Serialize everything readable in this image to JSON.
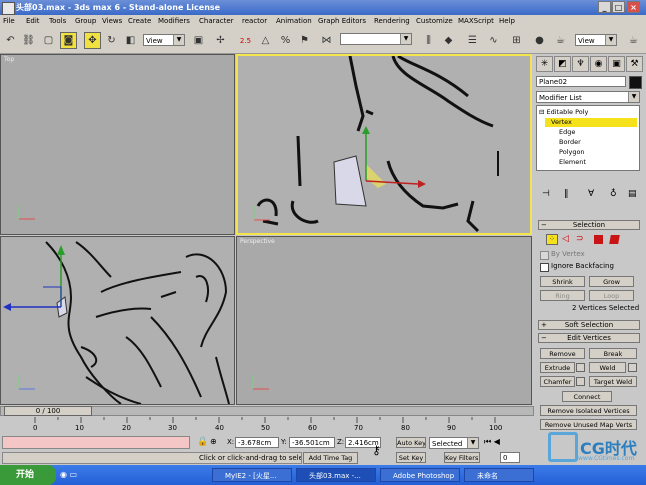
{
  "window": {
    "title": "头部03.max - 3ds max 6 - Stand-alone License",
    "min": "_",
    "max": "□",
    "close": "×"
  },
  "menu": [
    "File",
    "Edit",
    "Tools",
    "Group",
    "Views",
    "Create",
    "Modifiers",
    "Character",
    "reactor",
    "Animation",
    "Graph Editors",
    "Rendering",
    "Customize",
    "MAXScript",
    "Help"
  ],
  "toolbar": {
    "ref_coord": "View",
    "angle_snap": "2.5",
    "named_sel": "",
    "render_view": "View"
  },
  "viewports": {
    "top": "Top",
    "front": "",
    "left": "",
    "perspective": "Perspective"
  },
  "command_panel": {
    "object_name": "Plane02",
    "modifier_list": "Modifier List",
    "stack": [
      "Editable Poly",
      "Vertex",
      "Edge",
      "Border",
      "Polygon",
      "Element"
    ],
    "selection": {
      "title": "Selection",
      "by_vertex": "By Vertex",
      "ignore_backfacing": "Ignore Backfacing",
      "shrink": "Shrink",
      "grow": "Grow",
      "ring": "Ring",
      "loop": "Loop",
      "status": "2 Vertices Selected"
    },
    "soft_selection": "Soft Selection",
    "edit_vertices": {
      "title": "Edit Vertices",
      "remove": "Remove",
      "break": "Break",
      "extrude": "Extrude",
      "weld": "Weld",
      "chamfer": "Chamfer",
      "target_weld": "Target Weld",
      "connect": "Connect",
      "remove_isolated": "Remove Isolated Vertices",
      "remove_unused": "Remove Unused Map Verts"
    }
  },
  "timeline": {
    "frame": "0 / 100",
    "ticks": [
      "0",
      "10",
      "20",
      "30",
      "40",
      "50",
      "60",
      "70",
      "80",
      "90",
      "100"
    ]
  },
  "status": {
    "prompt": "Click or click-and-drag to select ob",
    "x_label": "X:",
    "x": "-3.678cm",
    "y_label": "Y:",
    "y": "-36.501cm",
    "z_label": "Z:",
    "z": "2.416cm",
    "add_time_tag": "Add Time Tag",
    "auto_key": "Auto Key",
    "set_key": "Set Key",
    "selected": "Selected",
    "key_filters": "Key Filters...",
    "frame_field": "0"
  },
  "taskbar": {
    "start": "开始",
    "tasks": [
      "MyIE2 - [火星...",
      "头部03.max -...",
      "Adobe Photoshop",
      "未命名"
    ],
    "watermark": "CG时代",
    "watermark_url": "www.CGtimes.com"
  },
  "colors": {
    "viewport_bg": "#a9a9a9",
    "active_border": "#f3e44d",
    "selected_item": "#f5e21c",
    "taskbar": "#245fd6"
  }
}
